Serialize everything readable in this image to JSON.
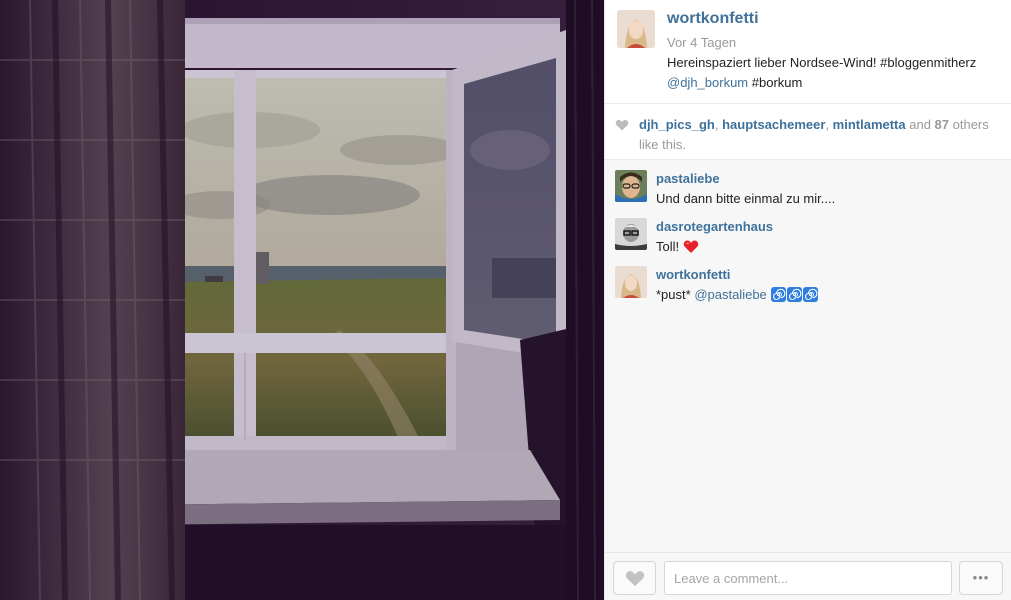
{
  "post": {
    "username": "wortkonfetti",
    "time_ago": "Vor 4 Tagen",
    "caption_text": "Hereinspaziert lieber Nordsee-Wind! #bloggenmitherz",
    "caption_mention": "@djh_borkum",
    "caption_tag": "#borkum"
  },
  "likes": {
    "users": [
      "djh_pics_gh",
      "hauptsachemeer",
      "mintlametta"
    ],
    "sep1": ", ",
    "sep2": ", ",
    "and_text": " and ",
    "count": "87",
    "suffix": " others like this."
  },
  "comments": [
    {
      "username": "pastaliebe",
      "text": "Und dann bitte einmal zu mir...."
    },
    {
      "username": "dasrotegartenhaus",
      "text": "Toll! ",
      "emoji": "heart"
    },
    {
      "username": "wortkonfetti",
      "text_prefix": "*pust* ",
      "mention": "@pastaliebe",
      "emoji": "cyclone-x3"
    }
  ],
  "footer": {
    "placeholder": "Leave a comment...",
    "more_label": "•••"
  },
  "colors": {
    "link": "#3f729b",
    "muted": "#999999",
    "heart_red": "#e8202a",
    "swirl_blue": "#2f7de1"
  },
  "icons": [
    "heart-icon",
    "more-icon"
  ]
}
